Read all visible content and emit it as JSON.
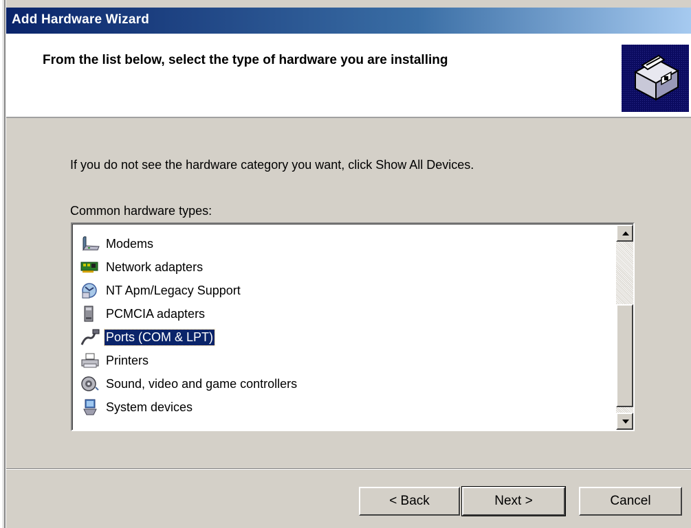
{
  "window": {
    "title": "Add Hardware Wizard"
  },
  "header": {
    "heading": "From the list below, select the type of hardware you are installing",
    "image_icon": "hardware-wizard-icon"
  },
  "body": {
    "info_text": "If you do not see the hardware category you want, click Show All Devices.",
    "list_label": "Common hardware types:"
  },
  "hardware_list": {
    "items": [
      {
        "label": "Modems",
        "icon": "modem-icon",
        "selected": false
      },
      {
        "label": "Network adapters",
        "icon": "network-adapter-icon",
        "selected": false
      },
      {
        "label": "NT Apm/Legacy Support",
        "icon": "legacy-support-icon",
        "selected": false
      },
      {
        "label": "PCMCIA adapters",
        "icon": "pcmcia-icon",
        "selected": false
      },
      {
        "label": "Ports (COM & LPT)",
        "icon": "port-icon",
        "selected": true
      },
      {
        "label": "Printers",
        "icon": "printer-icon",
        "selected": false
      },
      {
        "label": "Sound, video and game controllers",
        "icon": "speaker-icon",
        "selected": false
      },
      {
        "label": "System devices",
        "icon": "system-device-icon",
        "selected": false
      }
    ]
  },
  "buttons": {
    "back": "< Back",
    "next": "Next >",
    "cancel": "Cancel"
  },
  "colors": {
    "title_bar": "#0a246a",
    "selection": "#0a246a",
    "dialog_face": "#d4d0c8"
  }
}
